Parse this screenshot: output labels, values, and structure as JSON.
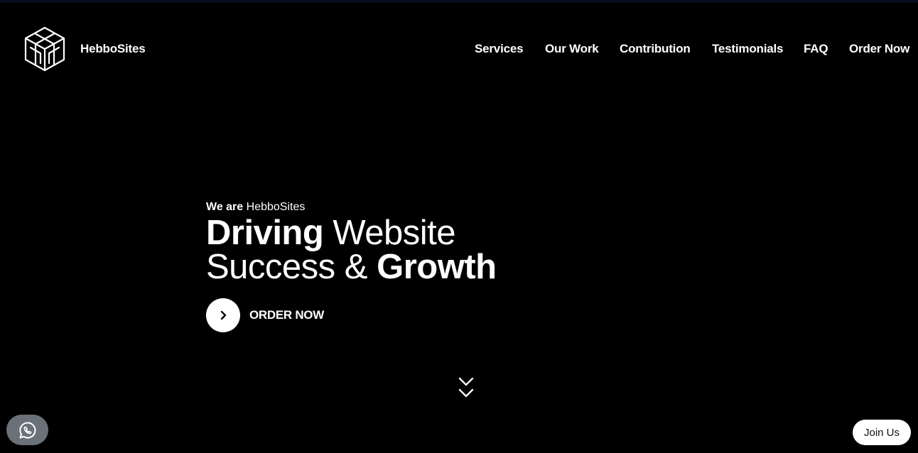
{
  "header": {
    "brand": "HebboSites",
    "logo_icon": "hebbosites-cube-logo-icon",
    "nav": [
      {
        "label": "Services"
      },
      {
        "label": "Our Work"
      },
      {
        "label": "Contribution"
      },
      {
        "label": "Testimonials"
      },
      {
        "label": "FAQ"
      },
      {
        "label": "Order Now"
      }
    ]
  },
  "hero": {
    "eyebrow_bold": "We are",
    "eyebrow_light": "HebboSites",
    "headline": {
      "part1_bold": "Driving",
      "part2": "Website",
      "part3": "Success &",
      "part4_bold": "Growth"
    },
    "cta_label": "ORDER NOW",
    "cta_icon": "chevron-right-icon"
  },
  "scroll_icon": "double-chevron-down-icon",
  "floating": {
    "whatsapp_icon": "whatsapp-icon",
    "join_label": "Join Us"
  },
  "colors": {
    "background": "#000000",
    "text": "#ffffff",
    "whatsapp_bg": "#6b7178",
    "join_bg": "#ffffff"
  }
}
